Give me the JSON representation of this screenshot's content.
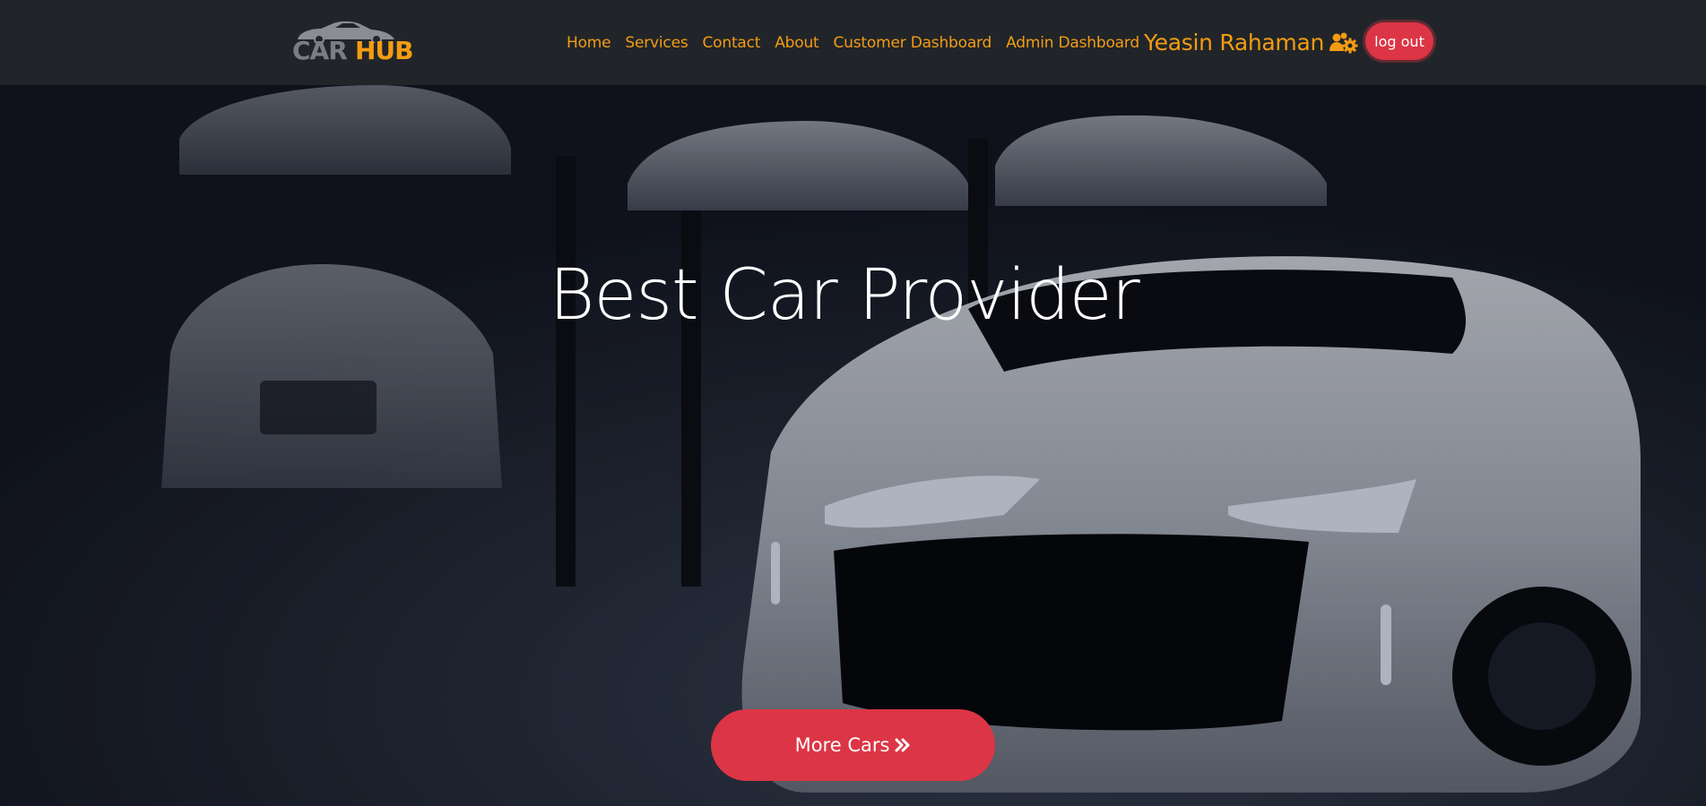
{
  "brand": {
    "logo_prefix": "CAR",
    "logo_suffix": "HUB"
  },
  "nav": {
    "items": [
      {
        "label": "Home"
      },
      {
        "label": "Services"
      },
      {
        "label": "Contact"
      },
      {
        "label": "About"
      },
      {
        "label": "Customer Dashboard"
      },
      {
        "label": "Admin Dashboard"
      }
    ],
    "user_name": "Yeasin Rahaman",
    "user_icon": "users-cog-icon",
    "logout_label": "log out"
  },
  "hero": {
    "title": "Best Car Provider",
    "cta_label": "More Cars",
    "cta_icon": "double-chevron-right-icon"
  },
  "colors": {
    "navbar_bg": "#212529",
    "accent": "#f39c12",
    "button": "#dc3545"
  }
}
